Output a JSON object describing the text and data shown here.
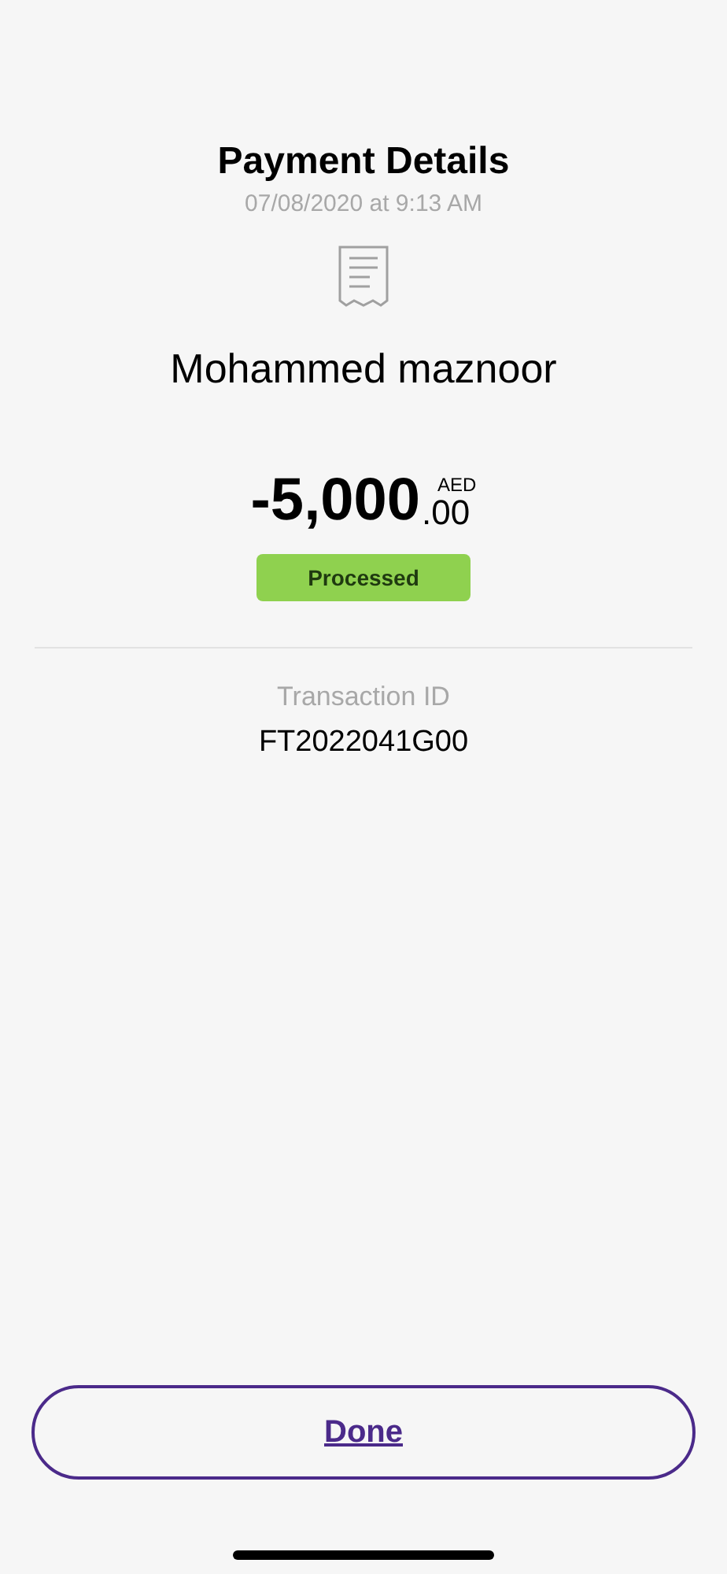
{
  "title": "Payment Details",
  "timestamp": "07/08/2020 at 9:13 AM",
  "payee": "Mohammed maznoor",
  "amount": {
    "whole": "-5,000",
    "decimals": ".00",
    "currency": "AED"
  },
  "status": "Processed",
  "transaction": {
    "label": "Transaction ID",
    "value": "FT2022041G00"
  },
  "button": "Done"
}
